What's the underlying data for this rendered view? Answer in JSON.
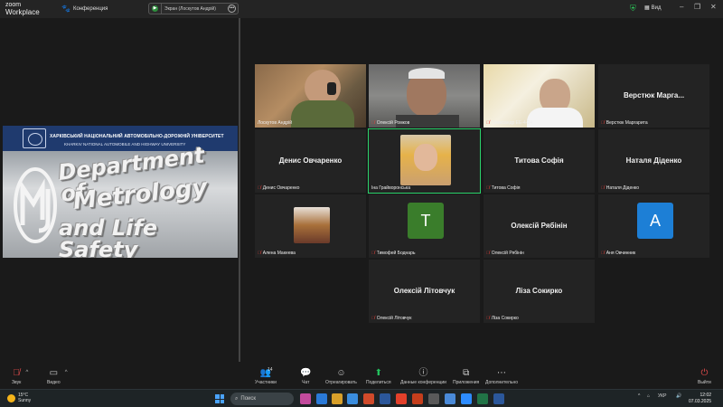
{
  "app": {
    "brand_line1": "zoom",
    "brand_line2": "Workplace"
  },
  "meeting": {
    "title": "Конференция",
    "paw_icon": "paw-icon"
  },
  "screen_share": {
    "label": "Экран (Лоскутов Андрій)"
  },
  "view": {
    "label": "Вид"
  },
  "shared_content": {
    "uni_ua": "ХАРКІВСЬКИЙ НАЦІОНАЛЬНИЙ АВТОМОБІЛЬНО-ДОРОЖНІЙ УНІВЕРСИТЕТ",
    "uni_en": "KHARKIV NATIONAL AUTOMOBILE AND HIGHWAY UNIVERSITY",
    "dept_line1": "Department of",
    "dept_line2": "Metrology",
    "dept_line3": "and Life Safety"
  },
  "participants": [
    {
      "label": "Лоскутов Андрій",
      "type": "video",
      "muted": false
    },
    {
      "label": "Олексій Ромков",
      "type": "video",
      "muted": true
    },
    {
      "label": "Олександр ЕЕ-4-24",
      "type": "video",
      "muted": true
    },
    {
      "label": "Верстюк Маргарита",
      "display_name": "Верстюк Марга...",
      "type": "name",
      "muted": true
    },
    {
      "label": "Денис Овчаренко",
      "display_name": "Денис Овчаренко",
      "type": "name",
      "muted": true
    },
    {
      "label": "Іна Грайворонська",
      "type": "photo",
      "muted": false,
      "active": true
    },
    {
      "label": "Титова Софія",
      "display_name": "Титова Софія",
      "type": "name",
      "muted": true
    },
    {
      "label": "Наталя Діденко",
      "display_name": "Наталя Діденко",
      "type": "name",
      "muted": true
    },
    {
      "label": "Алена Макеева",
      "type": "photo-small",
      "muted": true
    },
    {
      "label": "Тимофей Боднарь",
      "type": "letter",
      "letter": "T",
      "color": "#3a7d2b",
      "muted": true
    },
    {
      "label": "Олексій Рябінін",
      "display_name": "Олексій Рябінін",
      "type": "name",
      "muted": true
    },
    {
      "label": "Аня Овчинник",
      "type": "letter",
      "letter": "A",
      "color": "#1d7fd6",
      "muted": true
    },
    {
      "label": "Олексій Літовчук",
      "display_name": "Олексій Літовчук",
      "type": "name",
      "muted": true
    },
    {
      "label": "Ліза Сокирко",
      "display_name": "Ліза Сокирко",
      "type": "name",
      "muted": true
    }
  ],
  "toolbar": {
    "audio": "Звук",
    "video": "Видео",
    "participants": "Участники",
    "participants_count": "14",
    "chat": "Чат",
    "react": "Отреагировать",
    "share": "Поделиться",
    "meeting_info": "Данные конференции",
    "apps": "Приложения",
    "more": "Дополнительно",
    "leave": "Выйти"
  },
  "taskbar": {
    "weather_temp": "15°C",
    "weather_desc": "Sunny",
    "search_placeholder": "Поиск",
    "lang": "УКР",
    "time": "12:02",
    "date": "07.03.2025"
  },
  "colors": {
    "active_speaker": "#2bd36b",
    "mute_icon": "#e5413b",
    "share_green": "#23c35e",
    "leave_red": "#e34b4b"
  }
}
